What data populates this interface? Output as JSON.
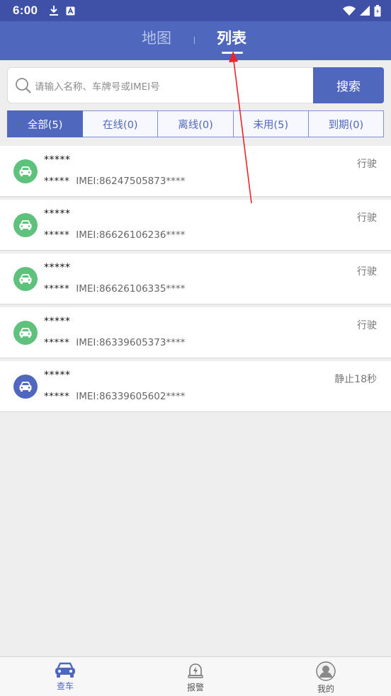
{
  "status_bar": {
    "time": "6:00",
    "icons_left": [
      "download-icon",
      "a-icon"
    ],
    "icons_right": [
      "wifi-icon",
      "signal-icon",
      "battery-icon"
    ]
  },
  "header": {
    "tabs": [
      {
        "label": "地图",
        "active": false
      },
      {
        "label": "列表",
        "active": true
      }
    ]
  },
  "search": {
    "placeholder": "请输入名称、车牌号或IMEI号",
    "button_label": "搜索"
  },
  "filters": [
    {
      "label": "全部(5)",
      "active": true
    },
    {
      "label": "在线(0)",
      "active": false
    },
    {
      "label": "离线(0)",
      "active": false
    },
    {
      "label": "未用(5)",
      "active": false
    },
    {
      "label": "到期(0)",
      "active": false
    }
  ],
  "vehicles": [
    {
      "name": "*****",
      "sub_name": "*****",
      "imei": "IMEI:86247505873****",
      "status": "行驶",
      "color": "#5ec27c"
    },
    {
      "name": "*****",
      "sub_name": "*****",
      "imei": "IMEI:86626106236****",
      "status": "行驶",
      "color": "#5ec27c"
    },
    {
      "name": "*****",
      "sub_name": "*****",
      "imei": "IMEI:86626106335****",
      "status": "行驶",
      "color": "#5ec27c"
    },
    {
      "name": "*****",
      "sub_name": "*****",
      "imei": "IMEI:86339605373****",
      "status": "行驶",
      "color": "#5ec27c"
    },
    {
      "name": "*****",
      "sub_name": "*****",
      "imei": "IMEI:86339605602****",
      "status": "静止18秒",
      "color": "#4f67bd"
    }
  ],
  "bottom_nav": [
    {
      "label": "查车",
      "icon": "car-icon",
      "active": true
    },
    {
      "label": "报警",
      "icon": "alarm-bell-icon",
      "active": false
    },
    {
      "label": "我的",
      "icon": "user-icon",
      "active": false
    }
  ],
  "colors": {
    "primary": "#4f67bd",
    "status_bar": "#3f51a6",
    "moving": "#5ec27c",
    "stopped": "#4f67bd",
    "annotation_arrow": "#e8262a"
  }
}
